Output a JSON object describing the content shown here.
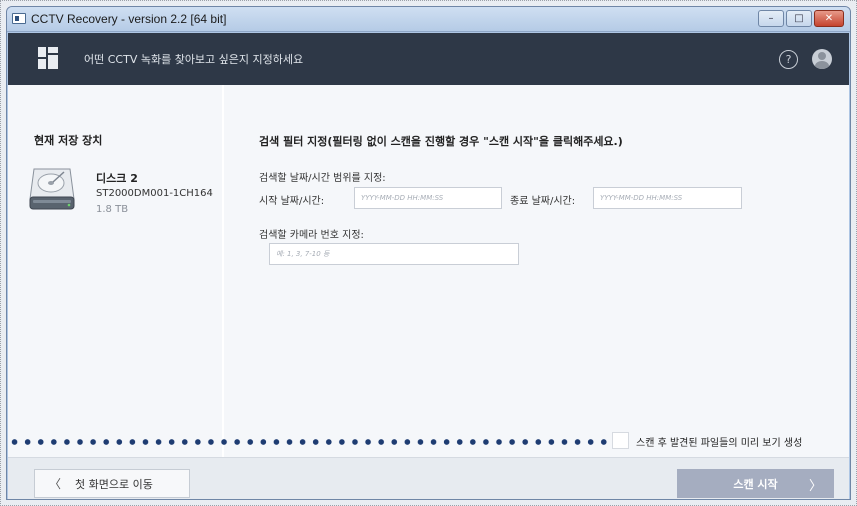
{
  "window": {
    "title": "CCTV Recovery - version 2.2 [64 bit]",
    "controls": {
      "minimize": "–",
      "maximize": "□",
      "close": "✕"
    }
  },
  "topbar": {
    "title": "어떤 CCTV 녹화를 찾아보고 싶은지 지정하세요",
    "help": "?"
  },
  "storage": {
    "heading": "현재 저장 장치",
    "disk_name": "디스크 2",
    "disk_model": "ST2000DM001-1CH164",
    "disk_size": "1.8 TB"
  },
  "filters": {
    "title": "검색 필터 지정(필터링 없이 스캔을 진행할 경우 \"스캔 시작\"을 클릭해주세요.)",
    "range_label": "검색할 날짜/시간 범위를 지정:",
    "start_label": "시작 날짜/시간:",
    "start_placeholder": "YYYY-MM-DD HH:MM:SS",
    "end_label": "종료 날짜/시간:",
    "end_placeholder": "YYYY-MM-DD HH:MM:SS",
    "camera_label": "검색할 카메라 번호 지정:",
    "camera_placeholder": "예: 1, 3, 7-10 등"
  },
  "preview": {
    "label": "스캔 후 발견된 파일들의 미리 보기 생성",
    "checked": false
  },
  "footer": {
    "back_label": "첫 화면으로 이동",
    "start_label": "스캔 시작",
    "back_chevron": "〈",
    "start_chevron": "〉"
  },
  "colors": {
    "topbar": "#2e3847",
    "start_button": "#a5adc0",
    "dots": "#1e3c72"
  }
}
